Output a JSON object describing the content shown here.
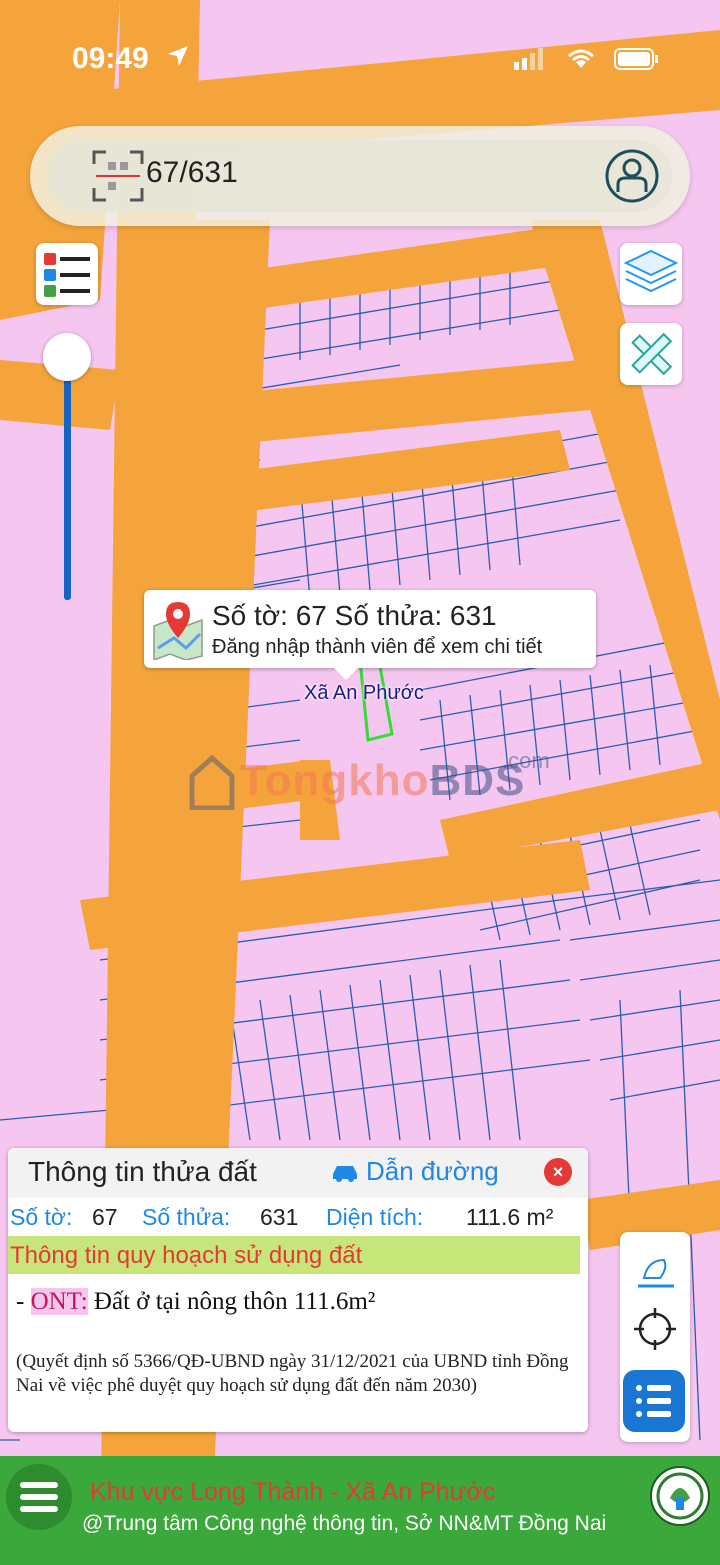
{
  "status": {
    "time": "09:49"
  },
  "search": {
    "query": "67/631"
  },
  "popup": {
    "title": "Số tờ: 67 Số thửa: 631",
    "subtitle": "Đăng nhập thành viên để xem chi tiết"
  },
  "map": {
    "label": "Xã An Phước"
  },
  "watermark": {
    "part1": "Tongkho",
    "part2": "BDS",
    "suffix": ".com"
  },
  "panel": {
    "title": "Thông tin thửa đất",
    "directions": "Dẫn đường",
    "sheet_label": "Số tờ:",
    "sheet_value": "67",
    "parcel_label": "Số thửa:",
    "parcel_value": "631",
    "area_label": "Diện tích:",
    "area_value": "111.6 m²",
    "plan_header": "Thông tin quy hoạch sử dụng đất",
    "ont_prefix": "- ",
    "ont_code": "ONT:",
    "ont_desc": " Đất ở tại nông thôn 111.6m²",
    "decision": "(Quyết định số 5366/QĐ-UBND ngày 31/12/2021 của UBND tỉnh Đồng Nai về việc phê duyệt quy hoạch sử dụng đất đến năm 2030)"
  },
  "footer": {
    "line1": "Khu vực Long Thành - Xã An Phước",
    "line2": "@Trung tâm Công nghệ thông tin, Sở NN&MT Đồng Nai"
  },
  "colors": {
    "road": "#f4a43a",
    "land": "#f5c6f0",
    "parcel_line": "#2a5db0",
    "footer": "#3aa83a",
    "accent": "#1e88e5",
    "highlight": "#33dd33"
  },
  "icons": [
    "location-arrow-icon",
    "signal-icon",
    "wifi-icon",
    "battery-icon",
    "qr-scan-icon",
    "user-icon",
    "legend-icon",
    "layers-icon",
    "ruler-pencil-icon",
    "map-pin-icon",
    "car-icon",
    "close-icon",
    "draw-icon",
    "crosshair-icon",
    "list-icon",
    "menu-icon",
    "logo-icon"
  ]
}
